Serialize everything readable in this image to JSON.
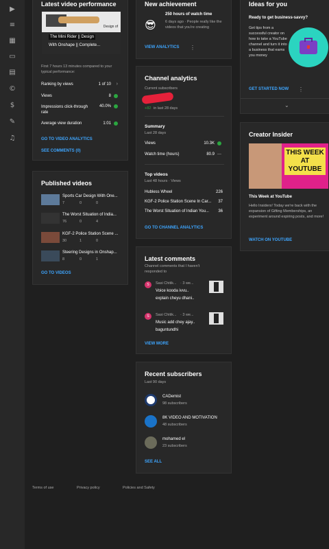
{
  "sidebar": {
    "icons": [
      "content-icon",
      "playlists-icon",
      "analytics-icon",
      "comments-icon",
      "subtitles-icon",
      "copyright-icon",
      "monetization-icon",
      "customization-icon",
      "audio-library-icon"
    ]
  },
  "video_perf": {
    "title": "Latest video performance",
    "thumb_caption_1": "The Mini Rider || Design",
    "thumb_caption_2": "With Onshape || Complete...",
    "thumb_overlay": "Design of",
    "compare": "First 7 hours 13 minutes compared to your typical performance:",
    "rows": [
      {
        "label": "Ranking by views",
        "value": "1 of 10",
        "suffix": "›"
      },
      {
        "label": "Views",
        "value": "8",
        "suffix": "ok"
      },
      {
        "label": "Impressions click-through rate",
        "value": "40.0%",
        "suffix": "ok"
      },
      {
        "label": "Average view duration",
        "value": "1:01",
        "suffix": "ok"
      }
    ],
    "link1": "GO TO VIDEO ANALYTICS",
    "link2": "SEE COMMENTS (0)"
  },
  "published": {
    "title": "Published videos",
    "items": [
      {
        "title": "Sports Car Design With One...",
        "views": "7",
        "comments": "0",
        "likes": "0"
      },
      {
        "title": "The Worst Situation of India...",
        "views": "76",
        "comments": "0",
        "likes": "4"
      },
      {
        "title": "KGF-2 Police Station Scene ...",
        "views": "30",
        "comments": "1",
        "likes": "0"
      },
      {
        "title": "Steering Designs in Onshap...",
        "views": "8",
        "comments": "0",
        "likes": "1"
      }
    ],
    "link": "GO TO VIDEOS"
  },
  "achievement": {
    "title": "New achievement",
    "headline": "250 hours of watch time",
    "desc": "6 days ago · People really like the videos that you're creating",
    "link": "VIEW ANALYTICS",
    "emoji": "😎"
  },
  "analytics": {
    "title": "Channel analytics",
    "subs_label": "Current subscribers",
    "subs_change": "+82",
    "subs_period": "in last 28 days",
    "summary_title": "Summary",
    "summary_period": "Last 28 days",
    "summary_rows": [
      {
        "label": "Views",
        "value": "10.3K",
        "indicator": "ok"
      },
      {
        "label": "Watch time (hours)",
        "value": "80.9",
        "indicator": "—"
      }
    ],
    "top_title": "Top videos",
    "top_period": "Last 48 hours · Views",
    "top_rows": [
      {
        "label": "Hubless Wheel",
        "value": "226"
      },
      {
        "label": "KGF-2 Police Station Scene In Car...",
        "value": "37"
      },
      {
        "label": "The Worst Situation of Indian You...",
        "value": "36"
      }
    ],
    "link": "GO TO CHANNEL ANALYTICS"
  },
  "comments": {
    "title": "Latest comments",
    "desc": "Channel comments that I haven't responded to",
    "items": [
      {
        "author": "Sasi Chitik...",
        "time": "· 3 we...",
        "text1": "Voice kooda ivvu..",
        "text2": "explain cheyu dhani..",
        "initial": "S"
      },
      {
        "author": "Sasi Chitik...",
        "time": "· 3 we...",
        "text1": "Music add chey ajay..",
        "text2": "baguntundhi",
        "initial": "S"
      }
    ],
    "link": "VIEW MORE"
  },
  "subscribers": {
    "title": "Recent subscribers",
    "period": "Last 90 days",
    "items": [
      {
        "name": "CADemist",
        "count": "98 subscribers"
      },
      {
        "name": "8K VIDEO AND MOTIVATION",
        "count": "48 subscribers"
      },
      {
        "name": "mohamed el",
        "count": "23 subscribers"
      }
    ],
    "link": "SEE ALL"
  },
  "ideas": {
    "title": "Ideas for you",
    "headline": "Ready to get business-savvy?",
    "body": "Get tips from a successful creator on how to take a YouTube channel and turn it into a business that earns you money",
    "link": "GET STARTED NOW"
  },
  "insider": {
    "title": "Creator Insider",
    "thumb_text": "THIS WEEK AT YOUTUBE",
    "headline": "This Week at YouTube",
    "body": "Hello Insiders! Today we're back with the expansion of Gifting Memberships, an experiment around expiring posts, and more!",
    "link": "WATCH ON YOUTUBE"
  },
  "footer": {
    "links": [
      "Terms of use",
      "Privacy policy",
      "Policies and Safety"
    ]
  },
  "colors": {
    "accent": "#3ea6ff",
    "ok": "#2ba640",
    "card": "#282828",
    "bg": "#1f1f1f"
  }
}
